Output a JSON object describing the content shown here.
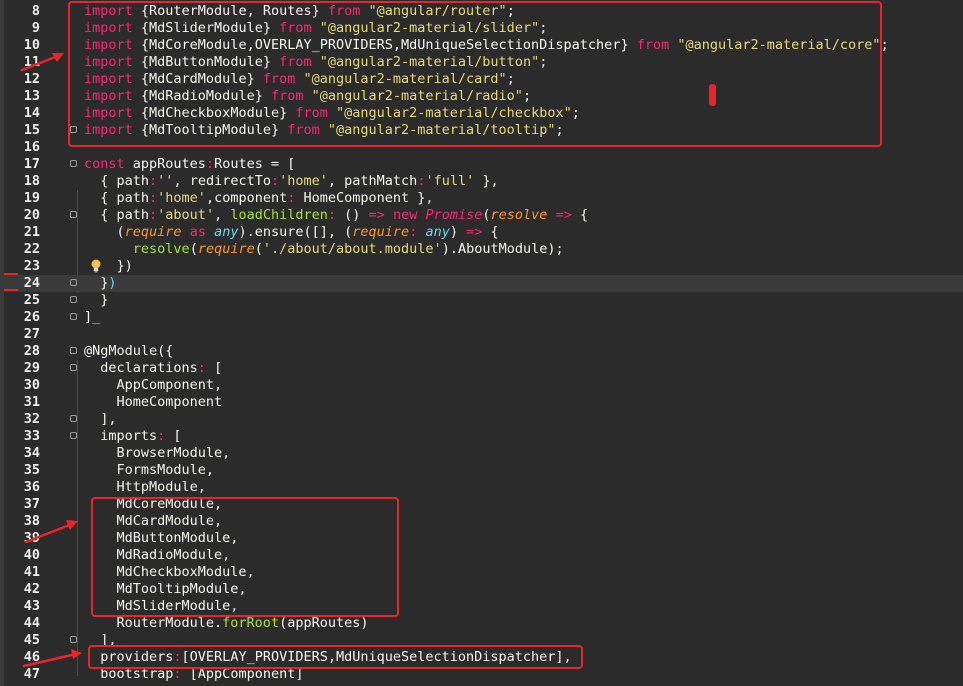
{
  "editor": {
    "current_line": 24,
    "lines": [
      {
        "n": "8",
        "t": [
          [
            "kw",
            "import"
          ],
          [
            "punc",
            " {RouterModule, Routes} "
          ],
          [
            "kw",
            "from"
          ],
          [
            "punc",
            " "
          ],
          [
            "str",
            "\"@angular/router\""
          ],
          [
            "punc",
            ";"
          ]
        ]
      },
      {
        "n": "9",
        "t": [
          [
            "kw",
            "import"
          ],
          [
            "punc",
            " {MdSliderModule} "
          ],
          [
            "kw",
            "from"
          ],
          [
            "punc",
            " "
          ],
          [
            "str",
            "\"@angular2-material/slider\""
          ],
          [
            "punc",
            ";"
          ]
        ]
      },
      {
        "n": "10",
        "t": [
          [
            "kw",
            "import"
          ],
          [
            "punc",
            " {MdCoreModule,OVERLAY_PROVIDERS,MdUniqueSelectionDispatcher} "
          ],
          [
            "kw",
            "from"
          ],
          [
            "punc",
            " "
          ],
          [
            "str",
            "\"@angular2-material/core\""
          ],
          [
            "punc",
            ";"
          ]
        ]
      },
      {
        "n": "11",
        "t": [
          [
            "kw",
            "import"
          ],
          [
            "punc",
            " {MdButtonModule} "
          ],
          [
            "kw",
            "from"
          ],
          [
            "punc",
            " "
          ],
          [
            "str",
            "\"@angular2-material/button\""
          ],
          [
            "punc",
            ";"
          ]
        ]
      },
      {
        "n": "12",
        "t": [
          [
            "kw",
            "import"
          ],
          [
            "punc",
            " {MdCardModule} "
          ],
          [
            "kw",
            "from"
          ],
          [
            "punc",
            " "
          ],
          [
            "str",
            "\"@angular2-material/card\""
          ],
          [
            "punc",
            ";"
          ]
        ]
      },
      {
        "n": "13",
        "t": [
          [
            "kw",
            "import"
          ],
          [
            "punc",
            " {MdRadioModule} "
          ],
          [
            "kw",
            "from"
          ],
          [
            "punc",
            " "
          ],
          [
            "str",
            "\"@angular2-material/radio\""
          ],
          [
            "punc",
            ";"
          ]
        ]
      },
      {
        "n": "14",
        "t": [
          [
            "kw",
            "import"
          ],
          [
            "punc",
            " {MdCheckboxModule} "
          ],
          [
            "kw",
            "from"
          ],
          [
            "punc",
            " "
          ],
          [
            "str",
            "\"@angular2-material/checkbox\""
          ],
          [
            "punc",
            ";"
          ]
        ]
      },
      {
        "n": "15",
        "t": [
          [
            "kw",
            "import"
          ],
          [
            "punc",
            " {MdTooltipModule} "
          ],
          [
            "kw",
            "from"
          ],
          [
            "punc",
            " "
          ],
          [
            "str",
            "\"@angular2-material/tooltip\""
          ],
          [
            "punc",
            ";"
          ]
        ]
      },
      {
        "n": "16",
        "t": []
      },
      {
        "n": "17",
        "t": [
          [
            "kw",
            "const"
          ],
          [
            "punc",
            " appRoutes"
          ],
          [
            "kw",
            ":"
          ],
          [
            "punc",
            "Routes = ["
          ]
        ]
      },
      {
        "n": "18",
        "t": [
          [
            "punc",
            "  { path"
          ],
          [
            "kw",
            ":"
          ],
          [
            "str",
            "''"
          ],
          [
            "punc",
            ", redirectTo"
          ],
          [
            "kw",
            ":"
          ],
          [
            "str",
            "'home'"
          ],
          [
            "punc",
            ", pathMatch"
          ],
          [
            "kw",
            ":"
          ],
          [
            "str",
            "'full'"
          ],
          [
            "punc",
            " },"
          ]
        ]
      },
      {
        "n": "19",
        "t": [
          [
            "punc",
            "  { path"
          ],
          [
            "kw",
            ":"
          ],
          [
            "str",
            "'home'"
          ],
          [
            "punc",
            ",component"
          ],
          [
            "kw",
            ":"
          ],
          [
            "punc",
            " HomeComponent },"
          ]
        ]
      },
      {
        "n": "20",
        "t": [
          [
            "punc",
            "  { path"
          ],
          [
            "kw",
            ":"
          ],
          [
            "str",
            "'about'"
          ],
          [
            "punc",
            ", "
          ],
          [
            "prop",
            "loadChildren"
          ],
          [
            "kw",
            ":"
          ],
          [
            "punc",
            " () "
          ],
          [
            "kw",
            "=>"
          ],
          [
            "punc",
            " "
          ],
          [
            "kw",
            "new"
          ],
          [
            "punc",
            " "
          ],
          [
            "kwi",
            "Promise"
          ],
          [
            "punc",
            "("
          ],
          [
            "param",
            "resolve"
          ],
          [
            "punc",
            " "
          ],
          [
            "kw",
            "=>"
          ],
          [
            "punc",
            " {"
          ]
        ]
      },
      {
        "n": "21",
        "t": [
          [
            "punc",
            "    ("
          ],
          [
            "param",
            "require"
          ],
          [
            "punc",
            " "
          ],
          [
            "kw",
            "as"
          ],
          [
            "punc",
            " "
          ],
          [
            "typ",
            "any"
          ],
          [
            "punc",
            ").ensure([], ("
          ],
          [
            "param",
            "require"
          ],
          [
            "kw",
            ":"
          ],
          [
            "punc",
            " "
          ],
          [
            "typ",
            "any"
          ],
          [
            "punc",
            ") "
          ],
          [
            "kw",
            "=>"
          ],
          [
            "punc",
            " {"
          ]
        ]
      },
      {
        "n": "22",
        "t": [
          [
            "punc",
            "      "
          ],
          [
            "prop",
            "resolve"
          ],
          [
            "punc",
            "("
          ],
          [
            "param",
            "require"
          ],
          [
            "punc",
            "("
          ],
          [
            "str",
            "'./about/about.module'"
          ],
          [
            "punc",
            ").AboutModule);"
          ]
        ]
      },
      {
        "n": "23",
        "t": [
          [
            "punc",
            "    })"
          ]
        ]
      },
      {
        "n": "24",
        "t": [
          [
            "punc",
            "  }"
          ],
          [
            "fn",
            ")"
          ]
        ]
      },
      {
        "n": "25",
        "t": [
          [
            "punc",
            "  }"
          ]
        ]
      },
      {
        "n": "26",
        "t": [
          [
            "punc",
            "]"
          ],
          [
            "str",
            "_"
          ]
        ]
      },
      {
        "n": "27",
        "t": []
      },
      {
        "n": "28",
        "t": [
          [
            "punc",
            "@NgModule({"
          ]
        ]
      },
      {
        "n": "29",
        "t": [
          [
            "punc",
            "  declarations"
          ],
          [
            "kw",
            ":"
          ],
          [
            "punc",
            " ["
          ]
        ]
      },
      {
        "n": "30",
        "t": [
          [
            "punc",
            "    AppComponent,"
          ]
        ]
      },
      {
        "n": "31",
        "t": [
          [
            "punc",
            "    HomeComponent"
          ]
        ]
      },
      {
        "n": "32",
        "t": [
          [
            "punc",
            "  ],"
          ]
        ]
      },
      {
        "n": "33",
        "t": [
          [
            "punc",
            "  imports"
          ],
          [
            "kw",
            ":"
          ],
          [
            "punc",
            " ["
          ]
        ]
      },
      {
        "n": "34",
        "t": [
          [
            "punc",
            "    BrowserModule,"
          ]
        ]
      },
      {
        "n": "35",
        "t": [
          [
            "punc",
            "    FormsModule,"
          ]
        ]
      },
      {
        "n": "36",
        "t": [
          [
            "punc",
            "    HttpModule,"
          ]
        ]
      },
      {
        "n": "37",
        "t": [
          [
            "punc",
            "    MdCoreModule,"
          ]
        ]
      },
      {
        "n": "38",
        "t": [
          [
            "punc",
            "    MdCardModule,"
          ]
        ]
      },
      {
        "n": "39",
        "t": [
          [
            "punc",
            "    MdButtonModule,"
          ]
        ]
      },
      {
        "n": "40",
        "t": [
          [
            "punc",
            "    MdRadioModule,"
          ]
        ]
      },
      {
        "n": "41",
        "t": [
          [
            "punc",
            "    MdCheckboxModule,"
          ]
        ]
      },
      {
        "n": "42",
        "t": [
          [
            "punc",
            "    MdTooltipModule,"
          ]
        ]
      },
      {
        "n": "43",
        "t": [
          [
            "punc",
            "    MdSliderModule,"
          ]
        ]
      },
      {
        "n": "44",
        "t": [
          [
            "punc",
            "    RouterModule."
          ],
          [
            "prop",
            "forRoot"
          ],
          [
            "punc",
            "(appRoutes)"
          ]
        ]
      },
      {
        "n": "45",
        "t": [
          [
            "punc",
            "  ],"
          ]
        ]
      },
      {
        "n": "46",
        "t": [
          [
            "punc",
            "  providers"
          ],
          [
            "kw",
            ":"
          ],
          [
            "punc",
            "[OVERLAY_PROVIDERS,MdUniqueSelectionDispatcher],"
          ]
        ]
      },
      {
        "n": "47",
        "t": [
          [
            "punc",
            "  bootstrap"
          ],
          [
            "kw",
            ":"
          ],
          [
            "punc",
            " [AppComponent]"
          ]
        ]
      }
    ],
    "fold_markers": [
      "15",
      "17",
      "20",
      "24",
      "25",
      "26",
      "28",
      "29",
      "32",
      "33",
      "45"
    ]
  },
  "annotations": {
    "color": "#e8262a",
    "boxes": [
      "imports-8-15",
      "imports-37-43",
      "providers-46"
    ]
  },
  "icons": {
    "hint": "lightbulb-icon"
  }
}
